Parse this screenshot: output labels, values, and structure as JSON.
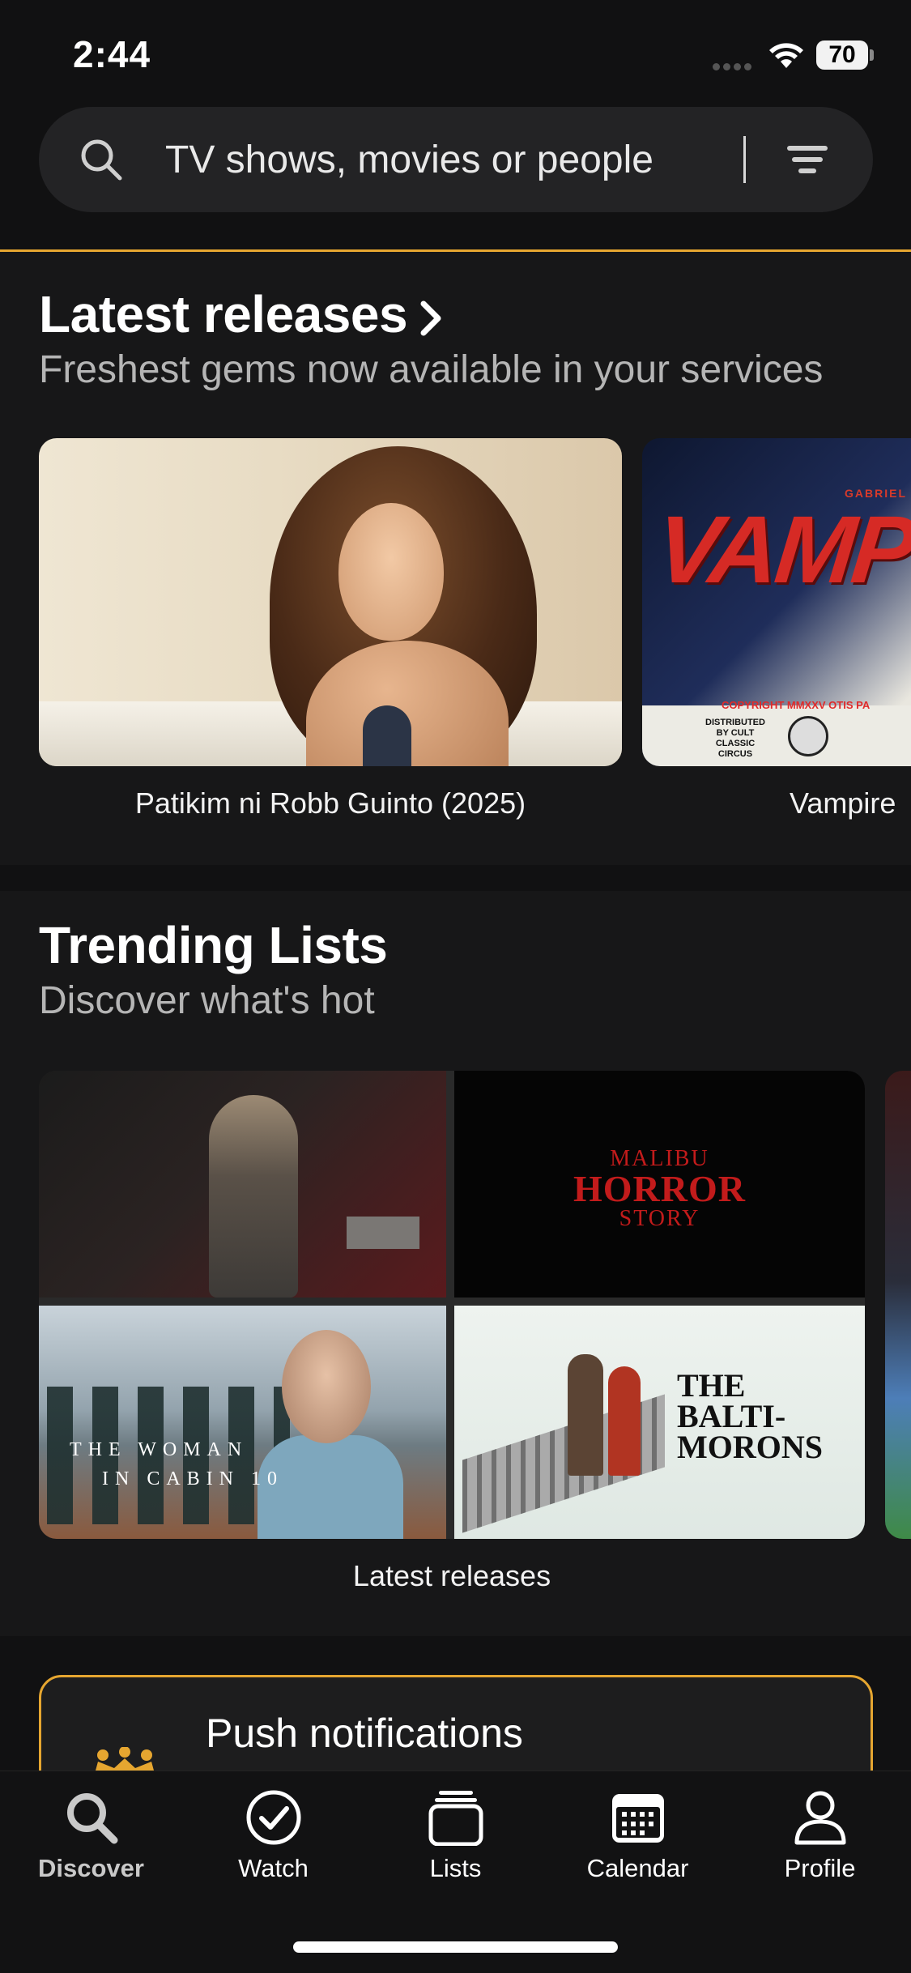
{
  "status": {
    "time": "2:44",
    "battery": "70"
  },
  "search": {
    "placeholder": "TV shows, movies or people"
  },
  "latest": {
    "title": "Latest releases",
    "subtitle": "Freshest gems now available in your services",
    "items": [
      {
        "caption": "Patikim ni Robb Guinto (2025)"
      },
      {
        "caption": "Vampire",
        "poster_title": "VAMPIR",
        "credit": "GABRIEL D",
        "copyright": "COPYRIGHT MMXXV OTIS PA",
        "distributor": "DISTRIBUTED BY CULT CLASSIC CIRCUS"
      }
    ]
  },
  "trending": {
    "title": "Trending Lists",
    "subtitle": "Discover what's hot",
    "lists": [
      {
        "caption": "Latest releases",
        "tiles": {
          "malibu": [
            "MALIBU",
            "HORROR",
            "STORY"
          ],
          "woman": [
            "THE WOMAN",
            "IN CABIN 10"
          ],
          "balti": [
            "THE",
            "BALTI-",
            "MORONS"
          ]
        }
      }
    ]
  },
  "push": {
    "title": "Push notifications"
  },
  "tabs": [
    {
      "label": "Discover",
      "icon": "search-icon",
      "active": true
    },
    {
      "label": "Watch",
      "icon": "check-circle-icon",
      "active": false
    },
    {
      "label": "Lists",
      "icon": "stack-icon",
      "active": false
    },
    {
      "label": "Calendar",
      "icon": "calendar-icon",
      "active": false
    },
    {
      "label": "Profile",
      "icon": "person-icon",
      "active": false
    }
  ],
  "colors": {
    "accent": "#e6a630",
    "background": "#111112",
    "card": "#232325"
  }
}
